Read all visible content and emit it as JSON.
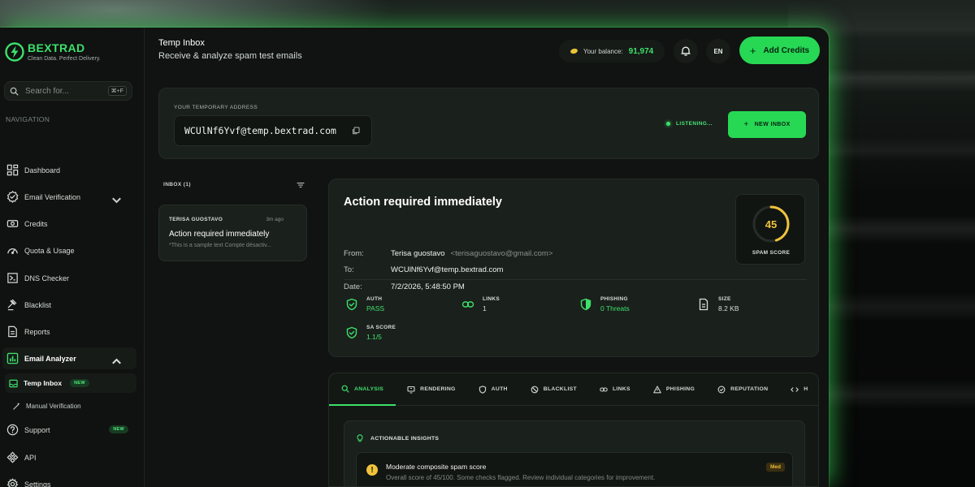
{
  "brand": {
    "name": "BEXTRAD",
    "tagline": "Clean Data. Perfect Delivery."
  },
  "search": {
    "placeholder": "Search for...",
    "shortcut": "⌘+F"
  },
  "sidebar": {
    "heading": "NAVIGATION",
    "items": [
      {
        "label": "Dashboard",
        "icon": "dashboard-icon"
      },
      {
        "label": "Email Verification",
        "icon": "verified-badge-icon"
      },
      {
        "label": "Credits",
        "icon": "credits-icon"
      },
      {
        "label": "Quota & Usage",
        "icon": "gauge-icon"
      },
      {
        "label": "DNS Checker",
        "icon": "dns-icon"
      },
      {
        "label": "Blacklist",
        "icon": "gavel-icon"
      },
      {
        "label": "Reports",
        "icon": "document-icon"
      },
      {
        "label": "Email Analyzer",
        "icon": "analytics-icon"
      },
      {
        "label": "Temp Inbox",
        "icon": "inbox-icon",
        "badge": "NEW"
      },
      {
        "label": "Manual Verification",
        "icon": "wand-icon"
      },
      {
        "label": "Support",
        "icon": "help-circle-icon",
        "badge": "NEW"
      },
      {
        "label": "API",
        "icon": "api-icon"
      },
      {
        "label": "Settings",
        "icon": "gear-icon"
      }
    ]
  },
  "header": {
    "title": "Temp Inbox",
    "subtitle": "Receive & analyze spam test emails",
    "balance_label": "Your balance:",
    "balance_value": "91,974",
    "language": "EN",
    "add_credits_label": "Add Credits"
  },
  "address": {
    "label": "YOUR TEMPORARY ADDRESS",
    "value": "WCUlNf6Yvf@temp.bextrad.com",
    "status": "LISTENING...",
    "new_inbox_label": "NEW INBOX"
  },
  "inbox": {
    "header": "INBOX (1)",
    "messages": [
      {
        "sender": "TERISA GUOSTAVO",
        "time": "3m ago",
        "subject": "Action required immediately",
        "preview": "*This is a sample text Compte désactiv..."
      }
    ]
  },
  "email": {
    "subject": "Action required immediately",
    "from_label": "From:",
    "from_name": "Terisa guostavo",
    "from_email": "<terisaguostavo@gmail.com>",
    "to_label": "To:",
    "to_value": "WCUlNf6Yvf@temp.bextrad.com",
    "date_label": "Date:",
    "date_value": "7/2/2026, 5:48:50 PM",
    "spam_score": 45,
    "spam_score_max": 100,
    "spam_score_label": "SPAM SCORE",
    "spam_score_color": "#f0c33c",
    "stats": [
      {
        "label": "AUTH",
        "value": "PASS",
        "icon": "shield-check-icon"
      },
      {
        "label": "LINKS",
        "value": "1",
        "icon": "link-icon"
      },
      {
        "label": "PHISHING",
        "value": "0 Threats",
        "icon": "shield-half-icon"
      },
      {
        "label": "SIZE",
        "value": "8.2 KB",
        "icon": "file-icon"
      },
      {
        "label": "SA SCORE",
        "value": "1.1/5",
        "icon": "shield-check-icon"
      }
    ]
  },
  "tabs": [
    {
      "label": "ANALYSIS",
      "icon": "search-analysis-icon",
      "active": true
    },
    {
      "label": "RENDERING",
      "icon": "monitor-icon"
    },
    {
      "label": "AUTH",
      "icon": "shield-icon"
    },
    {
      "label": "BLACKLIST",
      "icon": "ban-icon"
    },
    {
      "label": "LINKS",
      "icon": "link-icon"
    },
    {
      "label": "PHISHING",
      "icon": "warning-icon"
    },
    {
      "label": "REPUTATION",
      "icon": "check-circle-icon"
    },
    {
      "label": "H",
      "icon": "code-icon"
    }
  ],
  "insights": {
    "title": "ACTIONABLE INSIGHTS",
    "items": [
      {
        "title": "Moderate composite spam score",
        "description": "Overall score of 45/100. Some checks flagged. Review individual categories for improvement.",
        "severity": "Med",
        "icon": "warning-circle-icon",
        "icon_glyph": "!"
      }
    ]
  },
  "colors": {
    "accent": "#27d855",
    "accent_text": "#3ee06a",
    "warning": "#f0c33c"
  }
}
